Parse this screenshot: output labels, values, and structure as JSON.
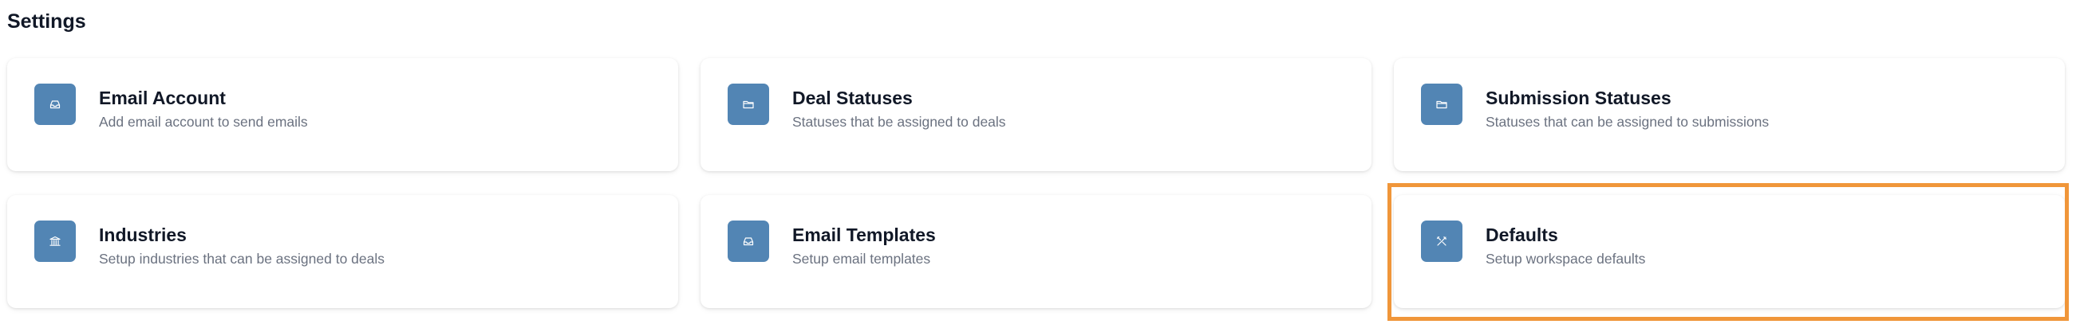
{
  "page": {
    "title": "Settings"
  },
  "colors": {
    "icon_tile": "#5285b4",
    "highlight": "#f0963a",
    "title_text": "#111827",
    "desc_text": "#6b7280"
  },
  "cards": [
    {
      "title": "Email Account",
      "description": "Add email account to send emails",
      "icon": "inbox-icon"
    },
    {
      "title": "Deal Statuses",
      "description": "Statuses that be assigned to deals",
      "icon": "folder-icon"
    },
    {
      "title": "Submission Statuses",
      "description": "Statuses that can be assigned to submissions",
      "icon": "folder-icon"
    },
    {
      "title": "Industries",
      "description": "Setup industries that can be assigned to deals",
      "icon": "building-icon"
    },
    {
      "title": "Email Templates",
      "description": "Setup email templates",
      "icon": "inbox-icon"
    },
    {
      "title": "Defaults",
      "description": "Setup workspace defaults",
      "icon": "tools-icon",
      "highlighted": true
    }
  ]
}
